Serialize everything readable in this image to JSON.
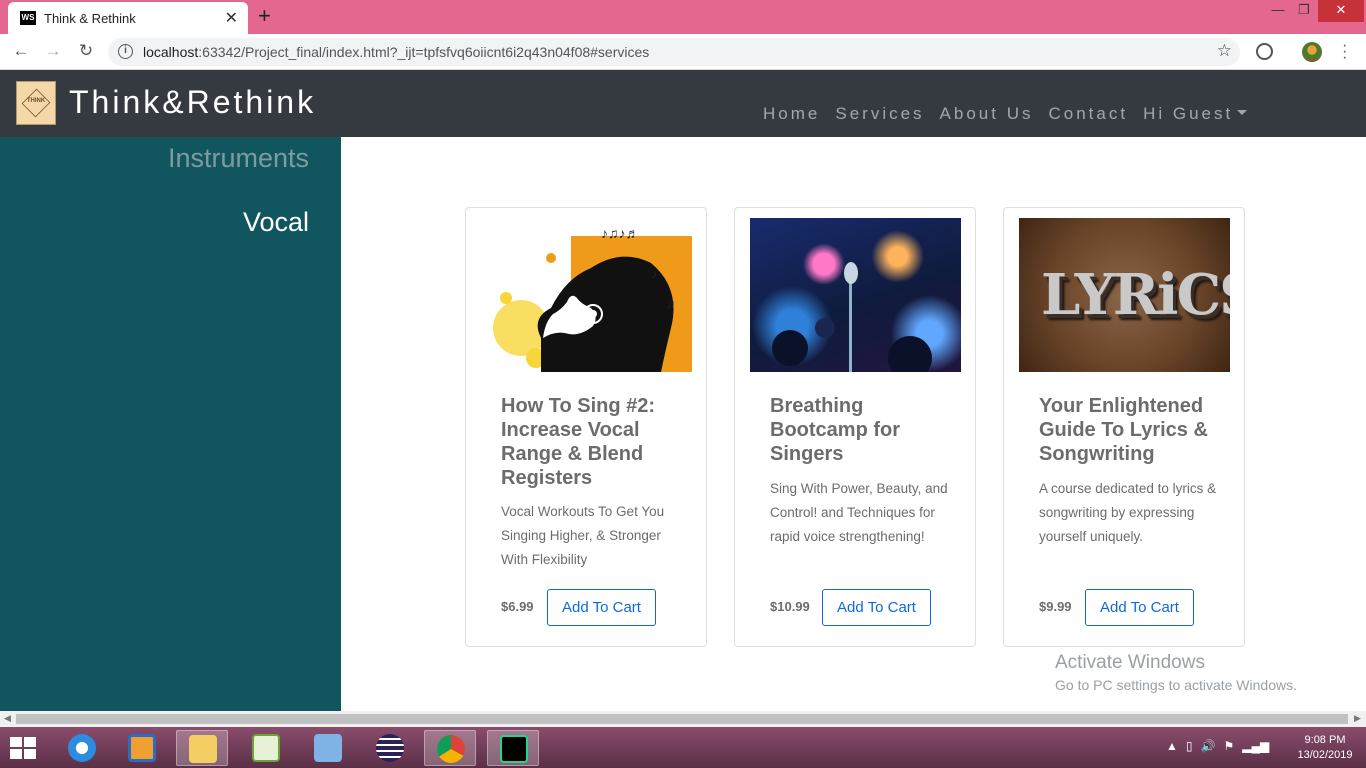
{
  "browser": {
    "tab_title": "Think & Rethink",
    "tab_favicon": "WS",
    "new_tab": "+",
    "url_host": "localhost",
    "url_rest": ":63342/Project_final/index.html?_ijt=tpfsfvq6oiicnt6i2q43n04f08#services"
  },
  "site": {
    "brand": "Think&Rethink",
    "logo_text": "THINK",
    "nav": [
      "Home",
      "Services",
      "About Us",
      "Contact",
      "Hi Guest"
    ]
  },
  "sidebar": {
    "items": [
      "Instruments",
      "Vocal"
    ]
  },
  "courses": [
    {
      "title": "How To Sing #2: Increase Vocal Range & Blend Registers",
      "description": "Vocal Workouts To Get You Singing Higher, & Stronger With Flexibility",
      "price": "$6.99",
      "button": "Add To Cart"
    },
    {
      "title": "Breathing Bootcamp for Singers",
      "description": "Sing With Power, Beauty, and Control! and Techniques for rapid voice strengthening!",
      "price": "$10.99",
      "button": "Add To Cart"
    },
    {
      "title": "Your Enlightened Guide To Lyrics & Songwriting",
      "description": "A course dedicated to lyrics & songwriting by expressing yourself uniquely.",
      "price": "$9.99",
      "button": "Add To Cart",
      "image_text": "LYRiCS"
    }
  ],
  "watermark": {
    "title": "Activate Windows",
    "subtitle": "Go to PC settings to activate Windows."
  },
  "taskbar": {
    "time": "9:08 PM",
    "date": "13/02/2019",
    "apps": [
      "internet-explorer-icon",
      "media-player-icon",
      "file-explorer-icon",
      "notepad-plus-icon",
      "control-panel-icon",
      "eclipse-icon",
      "chrome-icon",
      "webstorm-icon"
    ]
  },
  "colors": {
    "tab_strip": "#e3678f",
    "navbar": "#343a40",
    "sidebar": "#11555f",
    "button_accent": "#0e6ad9"
  }
}
